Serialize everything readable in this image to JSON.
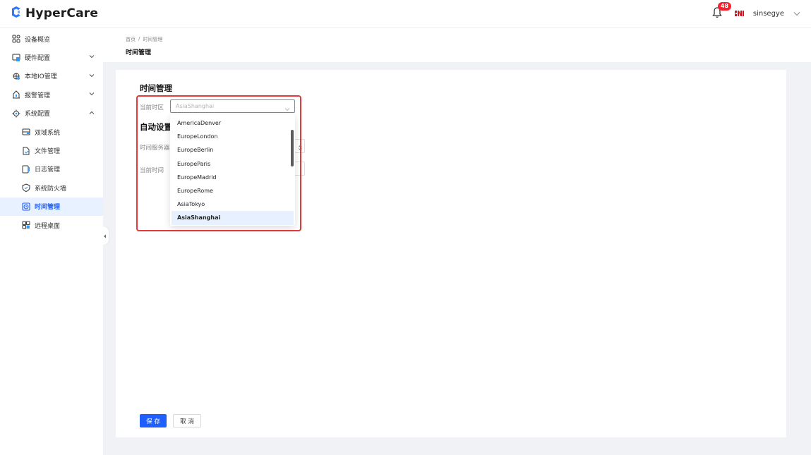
{
  "header": {
    "logo_text": "HyperCare",
    "notification_count": "48",
    "username": "sinsegye"
  },
  "sidebar": {
    "items": [
      {
        "label": "设备概览",
        "icon": "grid-icon",
        "expandable": false
      },
      {
        "label": "硬件配置",
        "icon": "hardware-icon",
        "expandable": true
      },
      {
        "label": "本地IO管理",
        "icon": "io-icon",
        "expandable": true
      },
      {
        "label": "报警管理",
        "icon": "alarm-icon",
        "expandable": true
      },
      {
        "label": "系统配置",
        "icon": "system-config-icon",
        "expandable": true,
        "expanded": true
      }
    ],
    "sub_items": [
      {
        "label": "双域系统",
        "icon": "dual-domain-icon"
      },
      {
        "label": "文件管理",
        "icon": "file-manage-icon"
      },
      {
        "label": "日志管理",
        "icon": "log-icon"
      },
      {
        "label": "系统防火墙",
        "icon": "firewall-icon"
      },
      {
        "label": "时间管理",
        "icon": "clock-icon",
        "active": true
      },
      {
        "label": "远程桌面",
        "icon": "remote-desktop-icon"
      }
    ]
  },
  "breadcrumb": {
    "home": "首页",
    "separator": "/",
    "current": "时间管理",
    "page_title": "时间管理"
  },
  "form": {
    "section_title": "时间管理",
    "timezone_label": "当前时区",
    "timezone_value": "AsiaShanghai",
    "auto_section_title": "自动设置",
    "time_server_label": "时间服务器",
    "current_time_label": "当前时间"
  },
  "dropdown": {
    "options": [
      "AmericaDenver",
      "EuropeLondon",
      "EuropeBerlin",
      "EuropeParis",
      "EuropeMadrid",
      "EuropeRome",
      "AsiaTokyo",
      "AsiaShanghai"
    ],
    "selected": "AsiaShanghai"
  },
  "actions": {
    "save_label": "保 存",
    "cancel_label": "取 消"
  },
  "colors": {
    "primary": "#1f5eff",
    "highlight_border": "#e53a3a",
    "badge": "#f5222d",
    "active_bg": "#e8f1ff"
  }
}
